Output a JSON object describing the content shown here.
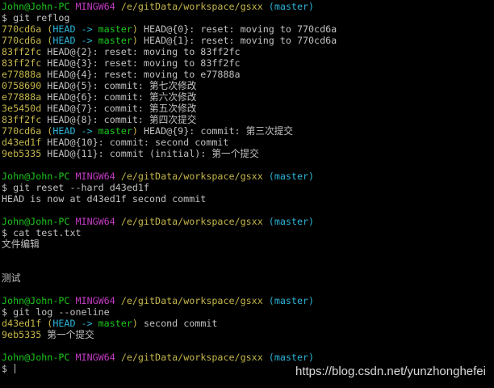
{
  "colors": {
    "background": "#000000",
    "text": "#c0c0c0",
    "prompt_user": "#1cc61c",
    "prompt_shell": "#c43ac4",
    "prompt_path": "#c4b64a",
    "branch": "#2cb4d8",
    "hash": "#c4b64a",
    "head_ref": "#2cb4d8",
    "master_ref": "#1cc61c"
  },
  "lines": [
    [
      {
        "t": "John@John-PC",
        "c": "green"
      },
      {
        "t": " ",
        "c": "white"
      },
      {
        "t": "MINGW64",
        "c": "magenta"
      },
      {
        "t": " ",
        "c": "white"
      },
      {
        "t": "/e/gitData/workspace/gsxx",
        "c": "yellow"
      },
      {
        "t": " ",
        "c": "white"
      },
      {
        "t": "(master)",
        "c": "cyan"
      }
    ],
    [
      {
        "t": "$ git reflog",
        "c": "white"
      }
    ],
    [
      {
        "t": "770cd6a",
        "c": "yellow"
      },
      {
        "t": " (",
        "c": "yellow"
      },
      {
        "t": "HEAD -> ",
        "c": "cyan"
      },
      {
        "t": "master",
        "c": "green"
      },
      {
        "t": ")",
        "c": "yellow"
      },
      {
        "t": " HEAD@{0}: reset: moving to 770cd6a",
        "c": "white"
      }
    ],
    [
      {
        "t": "770cd6a",
        "c": "yellow"
      },
      {
        "t": " (",
        "c": "yellow"
      },
      {
        "t": "HEAD -> ",
        "c": "cyan"
      },
      {
        "t": "master",
        "c": "green"
      },
      {
        "t": ")",
        "c": "yellow"
      },
      {
        "t": " HEAD@{1}: reset: moving to 770cd6a",
        "c": "white"
      }
    ],
    [
      {
        "t": "83ff2fc",
        "c": "yellow"
      },
      {
        "t": " HEAD@{2}: reset: moving to 83ff2fc",
        "c": "white"
      }
    ],
    [
      {
        "t": "83ff2fc",
        "c": "yellow"
      },
      {
        "t": " HEAD@{3}: reset: moving to 83ff2fc",
        "c": "white"
      }
    ],
    [
      {
        "t": "e77888a",
        "c": "yellow"
      },
      {
        "t": " HEAD@{4}: reset: moving to e77888a",
        "c": "white"
      }
    ],
    [
      {
        "t": "0758690",
        "c": "yellow"
      },
      {
        "t": " HEAD@{5}: commit: 第七次修改",
        "c": "white"
      }
    ],
    [
      {
        "t": "e77888a",
        "c": "yellow"
      },
      {
        "t": " HEAD@{6}: commit: 第六次修改",
        "c": "white"
      }
    ],
    [
      {
        "t": "3e5450d",
        "c": "yellow"
      },
      {
        "t": " HEAD@{7}: commit: 第五次修改",
        "c": "white"
      }
    ],
    [
      {
        "t": "83ff2fc",
        "c": "yellow"
      },
      {
        "t": " HEAD@{8}: commit: 第四次提交",
        "c": "white"
      }
    ],
    [
      {
        "t": "770cd6a",
        "c": "yellow"
      },
      {
        "t": " (",
        "c": "yellow"
      },
      {
        "t": "HEAD -> ",
        "c": "cyan"
      },
      {
        "t": "master",
        "c": "green"
      },
      {
        "t": ")",
        "c": "yellow"
      },
      {
        "t": " HEAD@{9}: commit: 第三次提交",
        "c": "white"
      }
    ],
    [
      {
        "t": "d43ed1f",
        "c": "yellow"
      },
      {
        "t": " HEAD@{10}: commit: second commit",
        "c": "white"
      }
    ],
    [
      {
        "t": "9eb5335",
        "c": "yellow"
      },
      {
        "t": " HEAD@{11}: commit (initial): 第一个提交",
        "c": "white"
      }
    ],
    [],
    [
      {
        "t": "John@John-PC",
        "c": "green"
      },
      {
        "t": " ",
        "c": "white"
      },
      {
        "t": "MINGW64",
        "c": "magenta"
      },
      {
        "t": " ",
        "c": "white"
      },
      {
        "t": "/e/gitData/workspace/gsxx",
        "c": "yellow"
      },
      {
        "t": " ",
        "c": "white"
      },
      {
        "t": "(master)",
        "c": "cyan"
      }
    ],
    [
      {
        "t": "$ git reset --hard d43ed1f",
        "c": "white"
      }
    ],
    [
      {
        "t": "HEAD is now at d43ed1f second commit",
        "c": "white"
      }
    ],
    [],
    [
      {
        "t": "John@John-PC",
        "c": "green"
      },
      {
        "t": " ",
        "c": "white"
      },
      {
        "t": "MINGW64",
        "c": "magenta"
      },
      {
        "t": " ",
        "c": "white"
      },
      {
        "t": "/e/gitData/workspace/gsxx",
        "c": "yellow"
      },
      {
        "t": " ",
        "c": "white"
      },
      {
        "t": "(master)",
        "c": "cyan"
      }
    ],
    [
      {
        "t": "$ cat test.txt",
        "c": "white"
      }
    ],
    [
      {
        "t": "文件编辑",
        "c": "white"
      }
    ],
    [],
    [],
    [
      {
        "t": "测试",
        "c": "white"
      }
    ],
    [],
    [
      {
        "t": "John@John-PC",
        "c": "green"
      },
      {
        "t": " ",
        "c": "white"
      },
      {
        "t": "MINGW64",
        "c": "magenta"
      },
      {
        "t": " ",
        "c": "white"
      },
      {
        "t": "/e/gitData/workspace/gsxx",
        "c": "yellow"
      },
      {
        "t": " ",
        "c": "white"
      },
      {
        "t": "(master)",
        "c": "cyan"
      }
    ],
    [
      {
        "t": "$ git log --oneline",
        "c": "white"
      }
    ],
    [
      {
        "t": "d43ed1f",
        "c": "yellow"
      },
      {
        "t": " (",
        "c": "yellow"
      },
      {
        "t": "HEAD -> ",
        "c": "cyan"
      },
      {
        "t": "master",
        "c": "green"
      },
      {
        "t": ")",
        "c": "yellow"
      },
      {
        "t": " second commit",
        "c": "white"
      }
    ],
    [
      {
        "t": "9eb5335",
        "c": "yellow"
      },
      {
        "t": " 第一个提交",
        "c": "white"
      }
    ],
    [],
    [
      {
        "t": "John@John-PC",
        "c": "green"
      },
      {
        "t": " ",
        "c": "white"
      },
      {
        "t": "MINGW64",
        "c": "magenta"
      },
      {
        "t": " ",
        "c": "white"
      },
      {
        "t": "/e/gitData/workspace/gsxx",
        "c": "yellow"
      },
      {
        "t": " ",
        "c": "white"
      },
      {
        "t": "(master)",
        "c": "cyan"
      }
    ],
    [
      {
        "t": "$ ",
        "c": "white"
      }
    ]
  ],
  "watermark": "https://blog.csdn.net/yunzhonghefei"
}
